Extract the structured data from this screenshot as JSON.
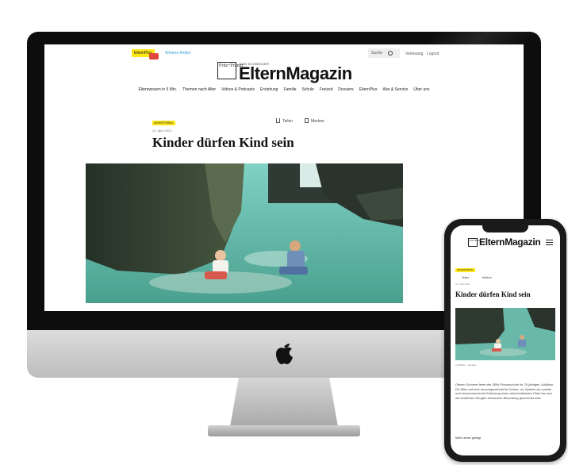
{
  "site": {
    "elternplus_badge": "ElternPlus",
    "top_promo": "Weitere Artikel",
    "search_label": "Suche",
    "top_links": [
      "Verlosung",
      "Logout"
    ],
    "logo_box_text": "Fritz+Fränzi",
    "logo_kicker": "DAS SCHWEIZER",
    "logo_word": "ElternMagazin",
    "nav": [
      "Elternwissen in 5 Min.",
      "Themen nach Alter",
      "Videos & Podcasts",
      "Erziehung",
      "Familie",
      "Schule",
      "Freizeit",
      "Dossiers",
      "ElternPlus",
      "Abo & Service",
      "Über uns"
    ]
  },
  "article": {
    "tag": "ADVERTORIAL",
    "date": "22. April 2022",
    "share_label": "Teilen",
    "merken_label": "Merken",
    "headline": "Kinder dürfen Kind sein"
  },
  "mobile": {
    "logo_word": "ElternMagazin",
    "tag": "ADVERTORIAL",
    "share_label": "Teilen",
    "merken_label": "Merken",
    "date": "22. April 2022",
    "headline": "Kinder dürfen Kind sein",
    "caption": "zvg/Bilder · Modelle",
    "body": "Diesen Sommer feiert die SBW Primarschule ihr 20-jähriges Jubiläum. Ein Blick auf eine aussergewöhnliche Schule, wo Spielen als soziale und sensomotorische Erfahrung einen entscheidenden Platz hat und die kindlichen Neugier besondere Beachtung geschenkt wird.",
    "more_label": "Mehr Lernen gefragt"
  },
  "colors": {
    "accent_yellow": "#ffe81a",
    "water": "#5fb7a6",
    "rock": "#2f3b2c"
  }
}
